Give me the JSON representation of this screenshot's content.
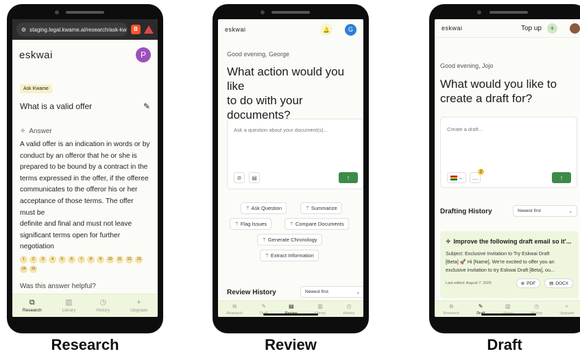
{
  "research": {
    "url": "staging.legal.kwame.ai/research/ask-kw",
    "logo": "eskwai",
    "avatar_letter": "P",
    "tag": "Ask Kwame",
    "question": "What is a valid offer",
    "answer_label": "Answer",
    "answer_lines": [
      "A valid offer is an indication in words or by",
      "conduct by an offeror that he or she is",
      "prepared to be bound by a contract in the",
      "terms expressed in the offer, if the offeree",
      "communicates to the offeror his or her",
      "acceptance of those terms. The offer must be",
      "definite and final and must not leave",
      "significant terms open for further negotiation"
    ],
    "citations": [
      "1",
      "2",
      "3",
      "4",
      "5",
      "6",
      "7",
      "8",
      "9",
      "10",
      "11",
      "12",
      "13",
      "14",
      "15"
    ],
    "helpful": "Was this answer helpful?",
    "tabs": [
      "Research",
      "Library",
      "History",
      "Upgrade"
    ],
    "caption": "Research"
  },
  "review": {
    "logo": "eskwai",
    "avatar_letter": "G",
    "greeting": "Good evening, George",
    "heading_lines": [
      "What action would you like",
      "to do with your",
      "documents?"
    ],
    "placeholder": "Ask a question about your document(s)...",
    "actions": [
      "Ask Question",
      "Summarize",
      "Flag Issues",
      "Compare Documents",
      "Generate Chronology",
      "Extract Information"
    ],
    "history_title": "Review History",
    "sort": "Newest first",
    "tabs": [
      "Research",
      "Draft",
      "Review",
      "Library",
      "History"
    ],
    "caption": "Review"
  },
  "draft": {
    "logo": "eskwai",
    "topup": "Top up",
    "greeting": "Good evening, Jojo",
    "heading_lines": [
      "What would you like to",
      "create a draft for?"
    ],
    "placeholder": "Create a draft...",
    "badge": "2",
    "history_title": "Drafting History",
    "sort": "Newest first",
    "card": {
      "title": "Improve the following draft email so it'...",
      "body_lines": [
        "Subject: Exclusive Invitation to Try Eskwai Draft",
        "[Beta] 🚀 Hi [Name], We're excited to offer you an",
        "exclusive invitation to try Eskwai Draft [Beta], ou..."
      ],
      "edited": "Last edited: August 7, 2025",
      "pdf": "PDF",
      "docx": "DOCX"
    },
    "tabs": [
      "Research",
      "Draft",
      "Library",
      "History",
      "Upgrade"
    ],
    "caption": "Draft"
  },
  "colors": {
    "green": "#3e8a4a",
    "tabbar": "#eff6de",
    "purple": "#9b4fc0",
    "blue": "#2f7fd6"
  }
}
